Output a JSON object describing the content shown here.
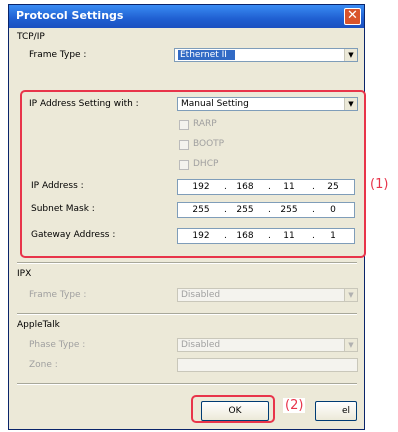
{
  "window": {
    "title": "Protocol Settings",
    "close_glyph": "✕"
  },
  "tcpip": {
    "section_label": "TCP/IP",
    "frame_type_label": "Frame Type :",
    "frame_type_value": "Ethernet II",
    "ip_setting_label": "IP Address Setting with :",
    "ip_setting_value": "Manual Setting",
    "options": [
      "RARP",
      "BOOTP",
      "DHCP"
    ],
    "ip_address_label": "IP Address :",
    "ip_address": [
      "192",
      "168",
      "11",
      "25"
    ],
    "subnet_label": "Subnet Mask :",
    "subnet": [
      "255",
      "255",
      "255",
      "0"
    ],
    "gateway_label": "Gateway Address :",
    "gateway": [
      "192",
      "168",
      "11",
      "1"
    ]
  },
  "ipx": {
    "section_label": "IPX",
    "frame_type_label": "Frame Type :",
    "frame_type_value": "Disabled"
  },
  "appletalk": {
    "section_label": "AppleTalk",
    "phase_type_label": "Phase Type :",
    "phase_type_value": "Disabled",
    "zone_label": "Zone :"
  },
  "buttons": {
    "ok_label": "OK",
    "cancel_partial": "el"
  },
  "callouts": {
    "one": "(1)",
    "two": "(2)"
  },
  "colors": {
    "callout": "#e8344a",
    "title_bar": "#1f5fd1",
    "selection": "#316ac5"
  },
  "icons": {
    "close": "close-icon",
    "dropdown": "chevron-down-icon"
  }
}
